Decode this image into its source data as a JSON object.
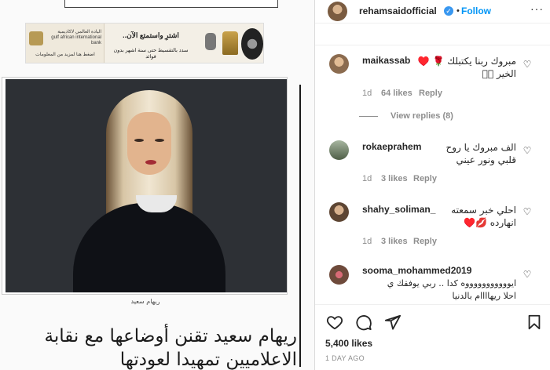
{
  "article": {
    "ad_brand": "اليادة العالمي لاكاديمية",
    "ad_brand_en": "gulf african international bank",
    "ad_cta": "اضغط هنا لمزيد من المعلومات",
    "ad_headline": "اشترِ واستمتع الآن..",
    "ad_body": "سدد بالتقسيط حتى سنة اشهر بدون فوائد",
    "photo_caption": "ريهام سعيد",
    "headline": "ريهام سعيد تقنن أوضاعها مع نقابة الاعلاميين تمهيدا لعودتها"
  },
  "post_header": {
    "username": "rehamsaidofficial",
    "verified_glyph": "✓",
    "separator": "•",
    "follow_label": "Follow",
    "more_label": "···"
  },
  "comments": [
    {
      "username": "maikassab",
      "text_line1": "مبروك ربنا يكتبلك 🌹 ♥️",
      "text_line2": "الخير 🏻🏻",
      "time": "1d",
      "likes": "64 likes",
      "reply": "Reply"
    },
    {
      "username": "rokaeprahem",
      "text_line1": "الف مبروك يا روح",
      "text_line2": "قلبي ونور عيني",
      "time": "1d",
      "likes": "3 likes",
      "reply": "Reply"
    },
    {
      "username": "shahy_soliman_",
      "text_line1": "احلي خبر سمعته",
      "text_line2": "انهارده 💋♥️",
      "time": "1d",
      "likes": "3 likes",
      "reply": "Reply"
    },
    {
      "username": "sooma_mohammed2019",
      "text_line1": "ايوووووووووووه كدا .. ربي يوفقك ي",
      "text_line2": "احلا ريهاااام بالدنيا",
      "time": "",
      "likes": "",
      "reply": ""
    }
  ],
  "view_replies_label": "View replies (8)",
  "actions": {
    "likes_count": "5,400 likes",
    "time_ago": "1 DAY AGO"
  },
  "icons": [
    "heart-icon",
    "comment-icon",
    "share-icon",
    "bookmark-icon",
    "more-icon",
    "verified-icon"
  ]
}
